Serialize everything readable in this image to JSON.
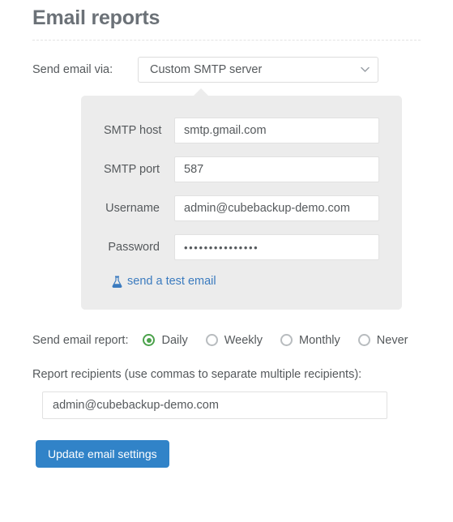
{
  "page": {
    "title": "Email reports"
  },
  "send_via": {
    "label": "Send email via:",
    "selected": "Custom SMTP server",
    "options": [
      "Custom SMTP server"
    ]
  },
  "smtp_panel": {
    "fields": [
      {
        "label": "SMTP host",
        "value": "smtp.gmail.com"
      },
      {
        "label": "SMTP port",
        "value": "587"
      },
      {
        "label": "Username",
        "value": "admin@cubebackup-demo.com"
      },
      {
        "label": "Password",
        "value": "•••••••••••••••"
      }
    ],
    "test_link": {
      "label": "send a test email",
      "icon": "flask-icon"
    }
  },
  "report_schedule": {
    "label": "Send email report:",
    "selected": "Daily",
    "options": [
      {
        "label": "Daily",
        "checked": true
      },
      {
        "label": "Weekly",
        "checked": false
      },
      {
        "label": "Monthly",
        "checked": false
      },
      {
        "label": "Never",
        "checked": false
      }
    ]
  },
  "recipients": {
    "label": "Report recipients (use commas to separate multiple recipients):",
    "value": "admin@cubebackup-demo.com",
    "placeholder": ""
  },
  "actions": {
    "submit_label": "Update email settings"
  },
  "colors": {
    "accent_blue": "#3183c8",
    "link_blue": "#3b7bbf",
    "radio_green": "#4ca24c",
    "panel_gray": "#ececec",
    "text_gray": "#55595c",
    "title_gray": "#6b7177"
  }
}
